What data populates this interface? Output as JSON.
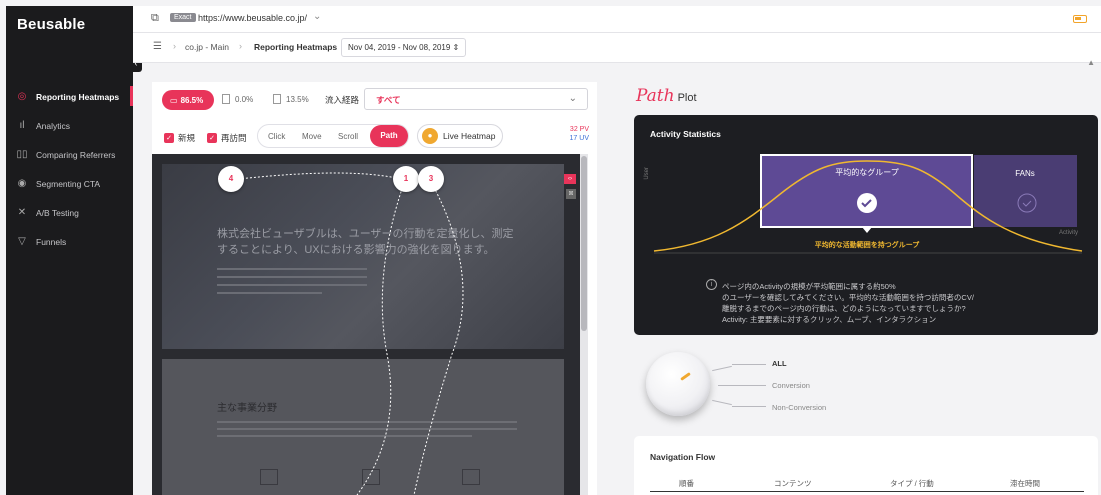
{
  "app": {
    "brand": "Beusable"
  },
  "sidebar": {
    "items": [
      {
        "label": "Reporting Heatmaps",
        "icon": "target-icon"
      },
      {
        "label": "Analytics",
        "icon": "bar-chart-icon"
      },
      {
        "label": "Comparing Referrers",
        "icon": "compare-icon"
      },
      {
        "label": "Segmenting CTA",
        "icon": "signal-icon"
      },
      {
        "label": "A/B Testing",
        "icon": "ab-tools-icon"
      },
      {
        "label": "Funnels",
        "icon": "funnel-icon"
      }
    ],
    "active_index": 0
  },
  "topbar": {
    "exact_badge": "Exact",
    "url": "https://www.beusable.co.jp/"
  },
  "breadcrumb": {
    "items": [
      "co.jp - Main",
      "Reporting Heatmaps"
    ],
    "date_range": "Nov 04, 2019 - Nov 08, 2019"
  },
  "stats": {
    "desktop_pct": "86.5%",
    "tablet_pct": "0.0%",
    "mobile_pct": "13.5%"
  },
  "referrer": {
    "label": "流入経路",
    "value": "すべて"
  },
  "filters": {
    "new_label": "新規",
    "return_label": "再訪問"
  },
  "modes": [
    "Click",
    "Move",
    "Scroll",
    "Path"
  ],
  "active_mode": "Path",
  "live_heatmap": "Live Heatmap",
  "pv": "32 PV",
  "uv": "17 UV",
  "heatmap": {
    "hero_text": "株式会社ビューザブルは、ユーザーの行動を定量化し、測定することにより、UXにおける影響力の強化を図ります。",
    "section_title": "主な事業分野",
    "path_nodes": [
      "4",
      "1",
      "3"
    ]
  },
  "path_plot": {
    "title_script": "Path",
    "title_rest": "Plot"
  },
  "activity": {
    "title": "Activity Statistics",
    "y_axis": "User",
    "x_axis": "Activity",
    "group_label": "平均的なグループ",
    "fans_label": "FANs",
    "group_caption": "平均的な活動範囲を持つグループ",
    "note_lines": [
      "ページ内のActivityの規模が平均範囲に属する約50%",
      "のユーザーを確認してみてください。平均的な活動範囲を持つ訪問者のCV/",
      "離脱するまでのページ内の行動は、どのようになっていますでしょうか?",
      "Activity: 主要要素に対するクリック、ムーブ、インタラクション"
    ]
  },
  "segments": {
    "all": "ALL",
    "conversion": "Conversion",
    "non_conversion": "Non-Conversion"
  },
  "navflow": {
    "title": "Navigation Flow",
    "columns": [
      "順番",
      "コンテンツ",
      "タイプ / 行動",
      "滞在時間"
    ]
  },
  "colors": {
    "accent": "#e8345a",
    "purple": "#5e4a95",
    "curve": "#f0b830"
  }
}
